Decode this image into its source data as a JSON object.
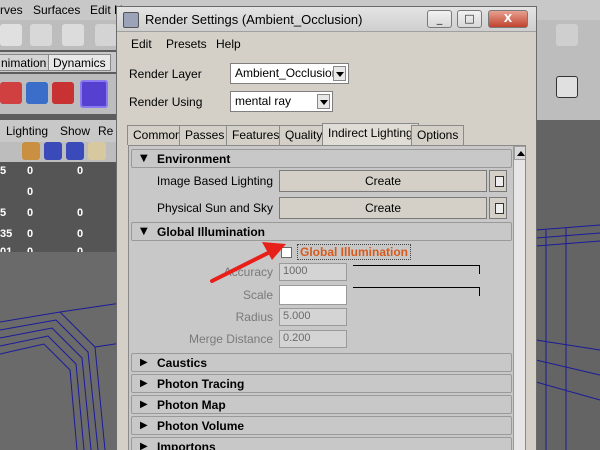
{
  "background": {
    "menus": [
      "rves",
      "Surfaces",
      "Edit N"
    ],
    "tabs": [
      "nimation",
      "Dynamics"
    ],
    "panel_menus": [
      "Lighting",
      "Show",
      "Re"
    ],
    "channel_values": [
      "5",
      "0",
      "0",
      "0",
      "5",
      "0",
      "0",
      "35",
      "0",
      "0",
      "01",
      "0",
      "0"
    ]
  },
  "window": {
    "title": "Render Settings (Ambient_Occlusion)",
    "buttons": [
      "_",
      "□",
      "X"
    ]
  },
  "menubar": [
    "Edit",
    "Presets",
    "Help"
  ],
  "render_layer": {
    "label": "Render Layer",
    "value": "Ambient_Occlusion"
  },
  "render_using": {
    "label": "Render Using",
    "value": "mental ray"
  },
  "tabs": [
    "Common",
    "Passes",
    "Features",
    "Quality",
    "Indirect Lighting",
    "Options"
  ],
  "active_tab": "Indirect Lighting",
  "environment": {
    "title": "Environment",
    "rows": [
      {
        "label": "Image Based Lighting",
        "button": "Create"
      },
      {
        "label": "Physical Sun and Sky",
        "button": "Create"
      }
    ]
  },
  "global_illumination": {
    "title": "Global Illumination",
    "checkbox_label": "Global Illumination",
    "checked": false,
    "fields": {
      "accuracy_label": "Accuracy",
      "accuracy_value": "1000",
      "scale_label": "Scale",
      "radius_label": "Radius",
      "radius_value": "5.000",
      "merge_label": "Merge Distance",
      "merge_value": "0.200"
    }
  },
  "collapsed_sections": [
    "Caustics",
    "Photon Tracing",
    "Photon Map",
    "Photon Volume",
    "Importons"
  ],
  "colors": {
    "annotation_arrow": "#e8201a",
    "gi_label": "#d75a1d"
  }
}
